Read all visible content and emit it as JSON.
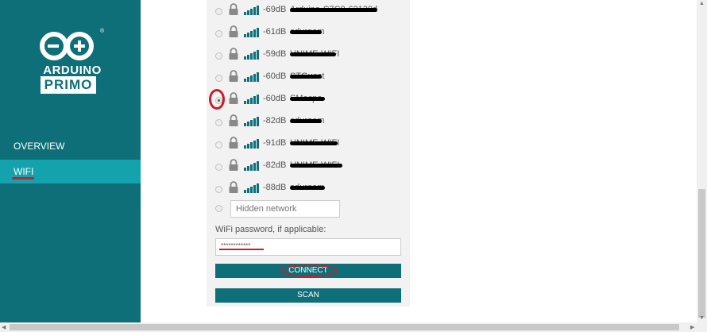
{
  "sidebar": {
    "logo": {
      "line1": "ARDUINO",
      "line2": "PRIMO",
      "reg": "®"
    },
    "nav": [
      {
        "label": "OVERVIEW",
        "active": false
      },
      {
        "label": "WIFI",
        "active": true
      }
    ],
    "colors": {
      "bg": "#0e6f78",
      "active_bg": "#14a2ac",
      "accent_red": "#c4202a"
    }
  },
  "networks": [
    {
      "signal": "-69dB",
      "ssid": "Arduino-C7C9-62138d",
      "selected": false
    },
    {
      "signal": "-61dB",
      "ssid": "eduroam",
      "selected": false
    },
    {
      "signal": "-59dB",
      "ssid": "UNIME-WIFI",
      "selected": false
    },
    {
      "signal": "-60dB",
      "ssid": "STGuest",
      "selected": false
    },
    {
      "signal": "-60dB",
      "ssid": "SMecpo",
      "selected": true
    },
    {
      "signal": "-82dB",
      "ssid": "eduroam",
      "selected": false
    },
    {
      "signal": "-91dB",
      "ssid": "UNIME-WIFI",
      "selected": false
    },
    {
      "signal": "-82dB",
      "ssid": "UNIME-WIFI",
      "selected": false
    },
    {
      "signal": "-88dB",
      "ssid": "eduroam",
      "selected": false
    }
  ],
  "hidden_network": {
    "placeholder": "Hidden network"
  },
  "password": {
    "label": "WiFi password, if applicable:",
    "value": "************"
  },
  "buttons": {
    "connect": "CONNECT",
    "scan": "SCAN"
  },
  "scroll_arrows": {
    "up": "▲",
    "down": "▼",
    "left": "◀",
    "right": "▶"
  }
}
